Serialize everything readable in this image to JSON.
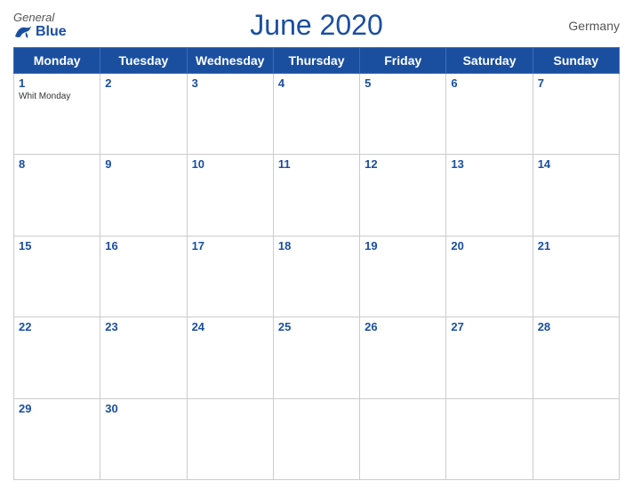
{
  "header": {
    "title": "June 2020",
    "country": "Germany",
    "logo": {
      "general": "General",
      "blue": "Blue"
    }
  },
  "weekdays": [
    "Monday",
    "Tuesday",
    "Wednesday",
    "Thursday",
    "Friday",
    "Saturday",
    "Sunday"
  ],
  "weeks": [
    [
      {
        "day": 1,
        "holiday": "Whit Monday"
      },
      {
        "day": 2
      },
      {
        "day": 3
      },
      {
        "day": 4
      },
      {
        "day": 5
      },
      {
        "day": 6
      },
      {
        "day": 7
      }
    ],
    [
      {
        "day": 8
      },
      {
        "day": 9
      },
      {
        "day": 10
      },
      {
        "day": 11
      },
      {
        "day": 12
      },
      {
        "day": 13
      },
      {
        "day": 14
      }
    ],
    [
      {
        "day": 15
      },
      {
        "day": 16
      },
      {
        "day": 17
      },
      {
        "day": 18
      },
      {
        "day": 19
      },
      {
        "day": 20
      },
      {
        "day": 21
      }
    ],
    [
      {
        "day": 22
      },
      {
        "day": 23
      },
      {
        "day": 24
      },
      {
        "day": 25
      },
      {
        "day": 26
      },
      {
        "day": 27
      },
      {
        "day": 28
      }
    ],
    [
      {
        "day": 29
      },
      {
        "day": 30
      },
      {
        "day": null
      },
      {
        "day": null
      },
      {
        "day": null
      },
      {
        "day": null
      },
      {
        "day": null
      }
    ]
  ]
}
